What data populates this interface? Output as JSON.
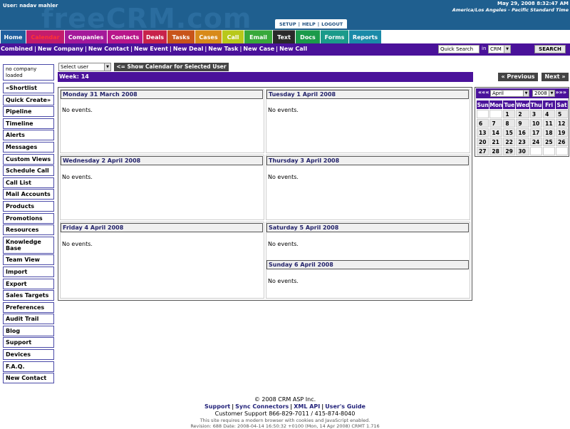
{
  "header": {
    "user_label": "User: nadav mahler",
    "watermark": "freeCRM.com",
    "date": "May 29, 2008 8:32:47 AM",
    "timezone": "America/Los Angeles - Pacific Standard Time",
    "util_nav": [
      "SETUP",
      "HELP",
      "LOGOUT"
    ]
  },
  "tabs": [
    {
      "label": "Home",
      "color": "#1f5f9f"
    },
    {
      "label": "Calendar",
      "color": "#c41c6c",
      "text_color": "#ff3333"
    },
    {
      "label": "Companies",
      "color": "#a4199a"
    },
    {
      "label": "Contacts",
      "color": "#b8168a"
    },
    {
      "label": "Deals",
      "color": "#c8224a"
    },
    {
      "label": "Tasks",
      "color": "#c8541a"
    },
    {
      "label": "Cases",
      "color": "#d88a1a"
    },
    {
      "label": "Call",
      "color": "#b8c81a"
    },
    {
      "label": "Email",
      "color": "#38a83a"
    },
    {
      "label": "Text",
      "color": "#2a2a2a"
    },
    {
      "label": "Docs",
      "color": "#1a9a4a"
    },
    {
      "label": "Forms",
      "color": "#1a9a8a"
    },
    {
      "label": "Reports",
      "color": "#1a8aa8"
    }
  ],
  "subnav": {
    "links": [
      "Combined",
      "New Company",
      "New Contact",
      "New Event",
      "New Deal",
      "New Task",
      "New Case",
      "New Call"
    ],
    "quick_search_value": "Quick Search",
    "in_label": "in",
    "search_scope": "CRM",
    "search_button": "SEARCH"
  },
  "sidebar": {
    "company_status": "no company loaded",
    "items": [
      "«Shortlist",
      "Quick Create»",
      "Pipeline",
      "Timeline",
      "Alerts",
      "Messages",
      "Custom Views",
      "Schedule Call",
      "Call List",
      "Mail Accounts",
      "Products",
      "Promotions",
      "Resources",
      "Knowledge Base",
      "Team View",
      "Import",
      "Export",
      "Sales Targets",
      "Preferences",
      "Audit Trail",
      "Blog",
      "Support",
      "Devices",
      "F.A.Q.",
      "New Contact"
    ]
  },
  "calendar": {
    "user_select": "Select user",
    "show_button": "<= Show Calendar for Selected User",
    "week_label": "Week: 14",
    "prev_button": "« Previous",
    "next_button": "Next »",
    "no_events": "No events.",
    "days": [
      "Monday 31 March 2008",
      "Tuesday 1 April 2008",
      "Wednesday 2 April 2008",
      "Thursday 3 April 2008",
      "Friday 4 April 2008",
      "Saturday 5 April 2008",
      "Sunday 6 April 2008"
    ]
  },
  "minical": {
    "prev": "«««",
    "next": "»»»",
    "month": "April",
    "year": "2008",
    "weekdays": [
      "Sun",
      "Mon",
      "Tue",
      "Wed",
      "Thu",
      "Fri",
      "Sat"
    ],
    "weeks": [
      [
        "",
        "",
        "1",
        "2",
        "3",
        "4",
        "5"
      ],
      [
        "6",
        "7",
        "8",
        "9",
        "10",
        "11",
        "12"
      ],
      [
        "13",
        "14",
        "15",
        "16",
        "17",
        "18",
        "19"
      ],
      [
        "20",
        "21",
        "22",
        "23",
        "24",
        "25",
        "26"
      ],
      [
        "27",
        "28",
        "29",
        "30",
        "",
        "",
        ""
      ]
    ]
  },
  "footer": {
    "copyright": "© 2008 CRM ASP Inc.",
    "links": [
      "Support",
      "Sync Connectors",
      "XML API",
      "User's Guide"
    ],
    "support_line": "Customer Support 866-829-7011 / 415-874-8040",
    "browser_note": "This site requires a modern browser with cookies and JavaScript enabled.",
    "revision": "Revision: 688 Date: 2008-04-14 16:50:32 +0100 (Mon, 14 Apr 2008) CRMT 1.716"
  }
}
